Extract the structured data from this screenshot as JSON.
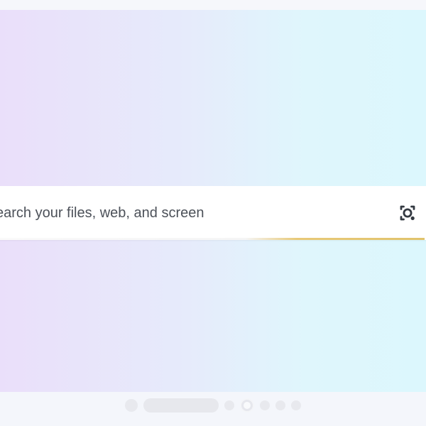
{
  "search": {
    "placeholder": "earch your files, web, and screen",
    "accent_color": "#e1c36b",
    "icon": "google-lens-icon"
  },
  "background": {
    "gradient_colors": [
      "#eadffa",
      "#e6ebfb",
      "#dff6fc",
      "#dcf7fd"
    ]
  },
  "page_indicator": {
    "active_page": 3,
    "items": [
      {
        "type": "dot",
        "icon": "page-dot-icon"
      },
      {
        "type": "pill",
        "icon": "page-pill-icon"
      },
      {
        "type": "dot",
        "icon": "page-dot-icon"
      },
      {
        "type": "active",
        "icon": "active-page-dot-icon"
      },
      {
        "type": "dot",
        "icon": "page-dot-icon"
      },
      {
        "type": "dot",
        "icon": "page-dot-icon"
      },
      {
        "type": "dot",
        "icon": "page-dot-icon"
      }
    ]
  }
}
